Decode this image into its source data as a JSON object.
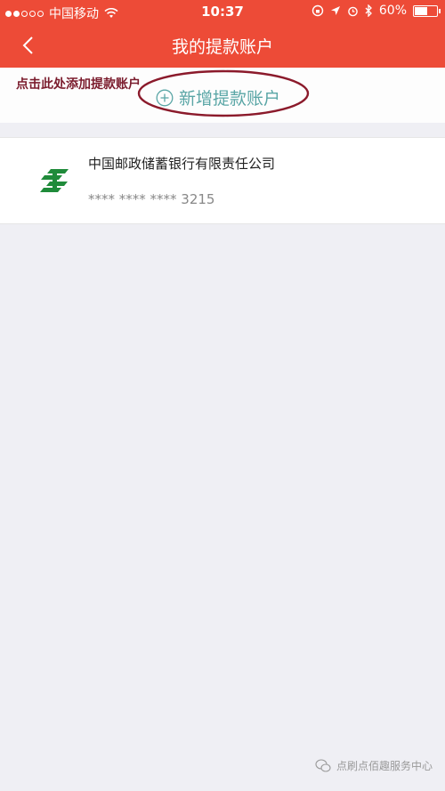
{
  "status_bar": {
    "carrier": "中国移动",
    "time": "10:37",
    "battery": "60%",
    "battery_level": 0.6
  },
  "nav": {
    "title": "我的提款账户"
  },
  "add_section": {
    "hint": "点击此处添加提款账户",
    "add_label": "新增提款账户"
  },
  "accounts": [
    {
      "bank_name": "中国邮政储蓄银行有限责任公司",
      "card_number": "**** **** **** 3215"
    }
  ],
  "watermark": {
    "text": "点刷点佰趣服务中心"
  },
  "colors": {
    "header": "#ed4b37",
    "add_label": "#5aa6a6",
    "hint": "#7a1b2c",
    "bank_logo": "#1f8b3a"
  }
}
